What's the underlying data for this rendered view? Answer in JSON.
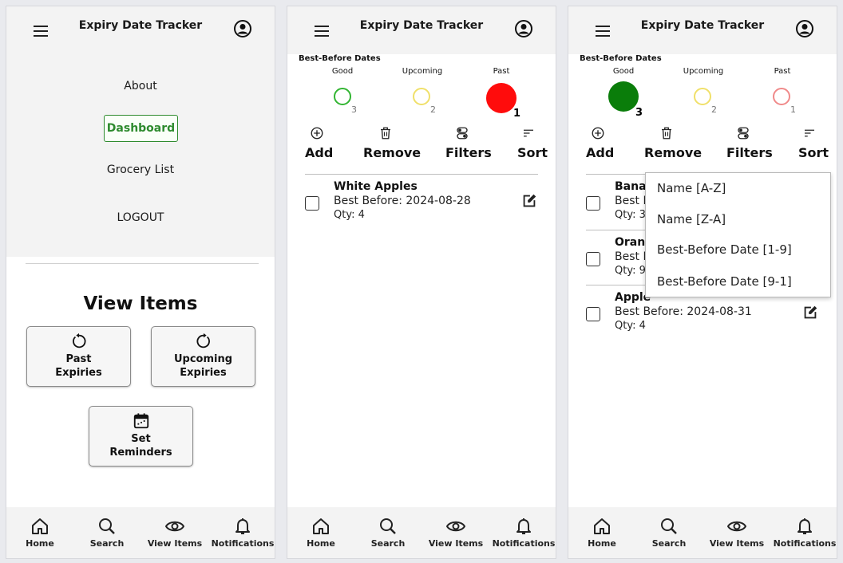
{
  "app": {
    "title": "Expiry Date Tracker"
  },
  "menu": {
    "about": "About",
    "dashboard": "Dashboard",
    "grocery_list": "Grocery List",
    "logout": "LOGOUT"
  },
  "view_items": {
    "title": "View Items",
    "past_line1": "Past",
    "past_line2": "Expiries",
    "upcoming_line1": "Upcoming",
    "upcoming_line2": "Expiries",
    "reminders_line1": "Set",
    "reminders_line2": "Reminders"
  },
  "nav": {
    "home": "Home",
    "search": "Search",
    "view_items": "View Items",
    "notifications": "Notifications"
  },
  "dashboard": {
    "section_title": "Best-Before Dates",
    "good_label": "Good",
    "upcoming_label": "Upcoming",
    "past_label": "Past",
    "good_count": "3",
    "upcoming_count": "2",
    "past_count": "1",
    "add": "Add",
    "remove": "Remove",
    "filters": "Filters",
    "sort": "Sort"
  },
  "colors": {
    "good": "#0a7d0a",
    "upcoming": "#f0e06a",
    "past": "#ff0c0c",
    "past_outline": "#f08a8a",
    "good_outline": "#33b533",
    "accent": "#2e8b2e"
  },
  "screen2": {
    "items": [
      {
        "name": "White Apples",
        "best_before": "Best Before: 2024-08-28",
        "qty": "Qty: 4"
      }
    ]
  },
  "screen3": {
    "items": [
      {
        "name": "Banar",
        "best_before": "Best B",
        "qty": "Qty: 3"
      },
      {
        "name": "Orang",
        "best_before": "Best B",
        "qty": "Qty: 9"
      },
      {
        "name": "Apple",
        "best_before": "Best Before: 2024-08-31",
        "qty": "Qty: 4"
      }
    ],
    "sort_options": [
      "Name [A-Z]",
      "Name [Z-A]",
      "Best-Before Date [1-9]",
      "Best-Before Date [9-1]"
    ]
  }
}
